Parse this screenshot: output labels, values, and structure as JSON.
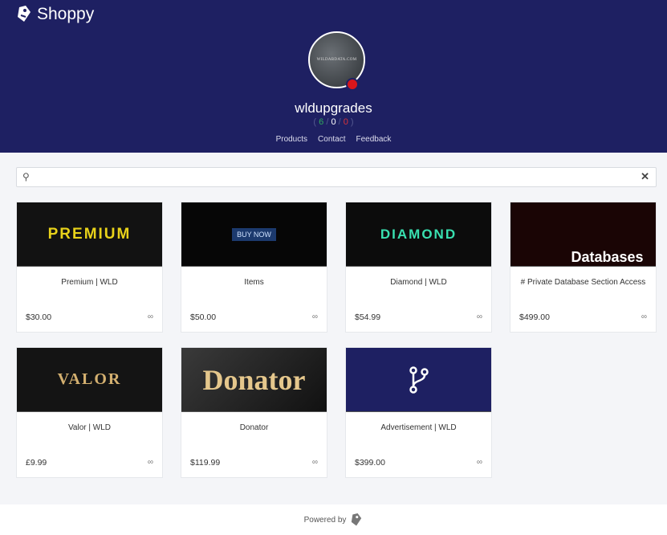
{
  "header": {
    "brand": "Shoppy",
    "avatar_text": "WILDABDATA.COM",
    "username": "wldupgrades",
    "stats": {
      "positive": "6",
      "neutral": "0",
      "negative": "0"
    },
    "nav": [
      "Products",
      "Contact",
      "Feedback"
    ]
  },
  "search": {
    "placeholder": "",
    "value": ""
  },
  "colors": {
    "header_bg": "#1e2062",
    "positive": "#2eaa5c",
    "negative": "#d8333a",
    "status": "#d8161c"
  },
  "products": [
    {
      "title": "Premium | WLD",
      "price": "$30.00",
      "stock": "∞",
      "image_text": "PREMIUM"
    },
    {
      "title": "Items",
      "price": "$50.00",
      "stock": "∞",
      "image_text": "BUY NOW"
    },
    {
      "title": "Diamond | WLD",
      "price": "$54.99",
      "stock": "∞",
      "image_text": "DIAMOND"
    },
    {
      "title": "# Private Database Section Access",
      "price": "$499.00",
      "stock": "∞",
      "image_text": "Databases"
    },
    {
      "title": "Valor | WLD",
      "price": "£9.99",
      "stock": "∞",
      "image_text": "VALOR"
    },
    {
      "title": "Donator",
      "price": "$119.99",
      "stock": "∞",
      "image_text": "Donator"
    },
    {
      "title": "Advertisement | WLD",
      "price": "$399.00",
      "stock": "∞",
      "image_icon": "git-branch-icon"
    }
  ],
  "footer": {
    "powered_by": "Powered by"
  }
}
